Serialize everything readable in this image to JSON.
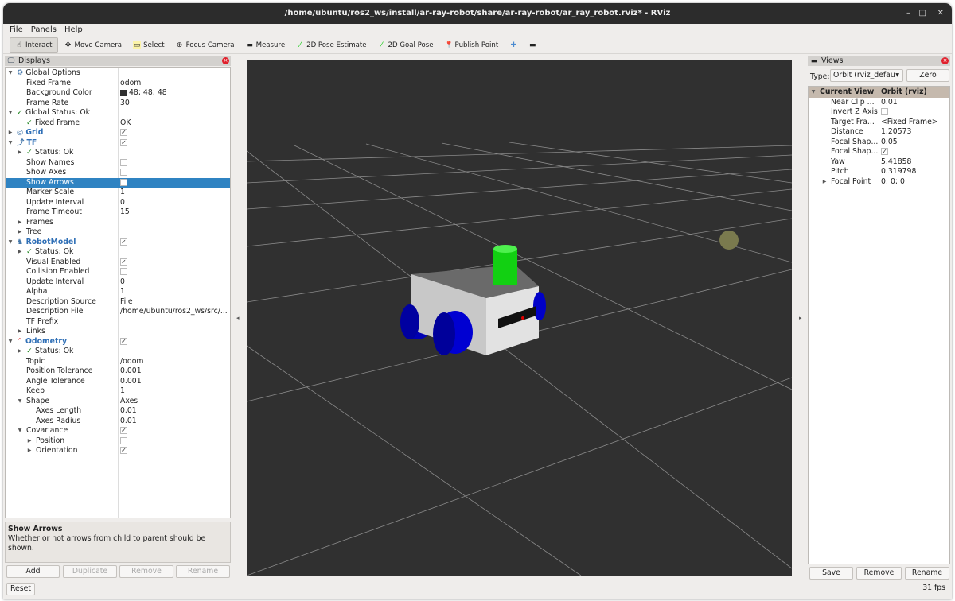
{
  "window": {
    "title": "/home/ubuntu/ros2_ws/install/ar-ray-robot/share/ar-ray-robot/ar_ray_robot.rviz* - RViz",
    "minimize": "–",
    "maximize": "□",
    "close": "✕"
  },
  "menu": [
    "File",
    "Panels",
    "Help"
  ],
  "toolbar": [
    {
      "label": "Interact",
      "icon": "hand-icon",
      "glyph": "☝",
      "active": true
    },
    {
      "label": "Move Camera",
      "icon": "move-camera-icon",
      "glyph": "✥"
    },
    {
      "label": "Select",
      "icon": "select-icon",
      "glyph": "▭"
    },
    {
      "label": "Focus Camera",
      "icon": "focus-camera-icon",
      "glyph": "⊕"
    },
    {
      "label": "Measure",
      "icon": "measure-icon",
      "glyph": "▬"
    },
    {
      "label": "2D Pose Estimate",
      "icon": "pose-estimate-icon",
      "glyph": "⁄"
    },
    {
      "label": "2D Goal Pose",
      "icon": "goal-pose-icon",
      "glyph": "⁄"
    },
    {
      "label": "Publish Point",
      "icon": "publish-point-icon",
      "glyph": "📍"
    },
    {
      "label": "",
      "icon": "plus-icon",
      "glyph": "✚"
    },
    {
      "label": "",
      "icon": "minus-icon",
      "glyph": "▬"
    }
  ],
  "displays": {
    "title": "Displays",
    "rows": [
      {
        "d": 0,
        "exp": "open",
        "icon": "⚙",
        "label": "Global Options"
      },
      {
        "d": 1,
        "label": "Fixed Frame",
        "value": "odom"
      },
      {
        "d": 1,
        "label": "Background Color",
        "value": "48; 48; 48",
        "color": "#303030"
      },
      {
        "d": 1,
        "label": "Frame Rate",
        "value": "30"
      },
      {
        "d": 0,
        "exp": "open",
        "check": true,
        "label": "Global Status: Ok"
      },
      {
        "d": 1,
        "check": true,
        "label": "Fixed Frame",
        "value": "OK"
      },
      {
        "d": 0,
        "exp": "closed",
        "icon": "◎",
        "label": "Grid",
        "blue": true,
        "cb": true
      },
      {
        "d": 0,
        "exp": "open",
        "icon": "⤴",
        "label": "TF",
        "blue": true,
        "cb": true
      },
      {
        "d": 1,
        "exp": "closed",
        "check": true,
        "label": "Status: Ok"
      },
      {
        "d": 1,
        "label": "Show Names",
        "cb": false
      },
      {
        "d": 1,
        "label": "Show Axes",
        "cb": false
      },
      {
        "d": 1,
        "label": "Show Arrows",
        "cb": false,
        "selected": true
      },
      {
        "d": 1,
        "label": "Marker Scale",
        "value": "1"
      },
      {
        "d": 1,
        "label": "Update Interval",
        "value": "0"
      },
      {
        "d": 1,
        "label": "Frame Timeout",
        "value": "15"
      },
      {
        "d": 1,
        "exp": "closed",
        "label": "Frames"
      },
      {
        "d": 1,
        "exp": "closed",
        "label": "Tree"
      },
      {
        "d": 0,
        "exp": "open",
        "icon": "♞",
        "label": "RobotModel",
        "blue": true,
        "cb": true
      },
      {
        "d": 1,
        "exp": "closed",
        "check": true,
        "label": "Status: Ok"
      },
      {
        "d": 1,
        "label": "Visual Enabled",
        "cb": true
      },
      {
        "d": 1,
        "label": "Collision Enabled",
        "cb": false
      },
      {
        "d": 1,
        "label": "Update Interval",
        "value": "0"
      },
      {
        "d": 1,
        "label": "Alpha",
        "value": "1"
      },
      {
        "d": 1,
        "label": "Description Source",
        "value": "File"
      },
      {
        "d": 1,
        "label": "Description File",
        "value": "/home/ubuntu/ros2_ws/src/..."
      },
      {
        "d": 1,
        "label": "TF Prefix"
      },
      {
        "d": 1,
        "exp": "closed",
        "label": "Links"
      },
      {
        "d": 0,
        "exp": "open",
        "icon": "⌃",
        "label": "Odometry",
        "blue": true,
        "cb": true
      },
      {
        "d": 1,
        "exp": "closed",
        "check": true,
        "label": "Status: Ok"
      },
      {
        "d": 1,
        "label": "Topic",
        "value": "/odom"
      },
      {
        "d": 1,
        "label": "Position Tolerance",
        "value": "0.001"
      },
      {
        "d": 1,
        "label": "Angle Tolerance",
        "value": "0.001"
      },
      {
        "d": 1,
        "label": "Keep",
        "value": "1"
      },
      {
        "d": 1,
        "exp": "open",
        "label": "Shape",
        "value": "Axes"
      },
      {
        "d": 2,
        "label": "Axes Length",
        "value": "0.01"
      },
      {
        "d": 2,
        "label": "Axes Radius",
        "value": "0.01"
      },
      {
        "d": 1,
        "exp": "open",
        "label": "Covariance",
        "cb": true
      },
      {
        "d": 2,
        "exp": "closed",
        "label": "Position",
        "cb": false
      },
      {
        "d": 2,
        "exp": "closed",
        "label": "Orientation",
        "cb": true
      }
    ],
    "description": {
      "title": "Show Arrows",
      "text": "Whether or not arrows from child to parent should be shown."
    },
    "buttons": {
      "add": "Add",
      "duplicate": "Duplicate",
      "remove": "Remove",
      "rename": "Rename"
    },
    "reset": "Reset"
  },
  "views": {
    "title": "Views",
    "type_label": "Type:",
    "type_value": "Orbit (rviz_defau",
    "zero": "Zero",
    "header": {
      "name": "Current View",
      "value": "Orbit (rviz)"
    },
    "rows": [
      {
        "label": "Near Clip ...",
        "value": "0.01"
      },
      {
        "label": "Invert Z Axis",
        "cb": false
      },
      {
        "label": "Target Fra...",
        "value": "<Fixed Frame>"
      },
      {
        "label": "Distance",
        "value": "1.20573"
      },
      {
        "label": "Focal Shap...",
        "value": "0.05"
      },
      {
        "label": "Focal Shap...",
        "cb": true
      },
      {
        "label": "Yaw",
        "value": "5.41858"
      },
      {
        "label": "Pitch",
        "value": "0.319798"
      },
      {
        "label": "Focal Point",
        "value": "0; 0; 0",
        "exp": "closed"
      }
    ],
    "buttons": {
      "save": "Save",
      "remove": "Remove",
      "rename": "Rename"
    }
  },
  "status": {
    "fps": "31 fps"
  },
  "colors": {
    "background": "#303030",
    "selection": "#2f83c2",
    "wheels": "#0000c8",
    "sensor": "#10e010",
    "body": "#c8c8c8"
  }
}
